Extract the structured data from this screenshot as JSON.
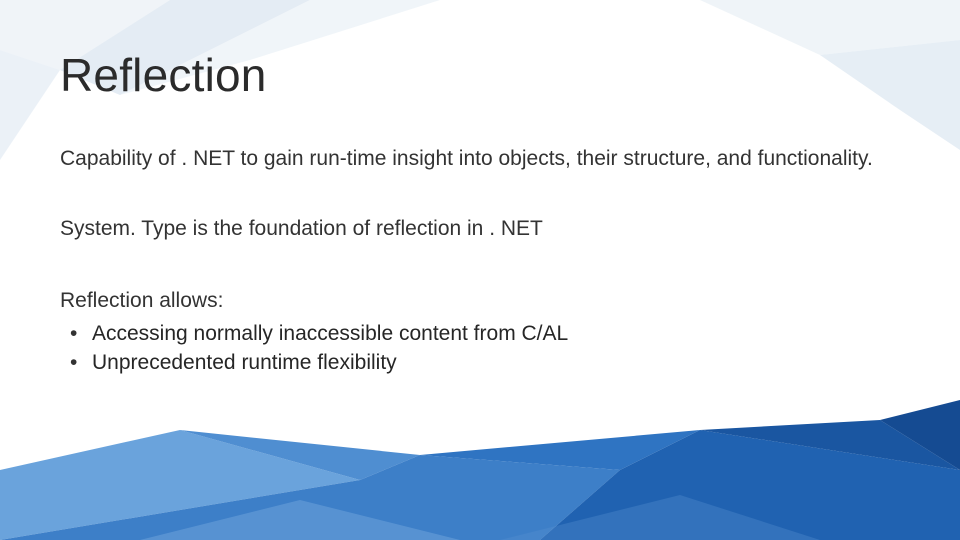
{
  "slide": {
    "title": "Reflection",
    "paragraph1": "Capability of . NET to gain run-time insight into objects, their structure, and functionality.",
    "paragraph2": "System. Type is the foundation of reflection in . NET",
    "allows_head": "Reflection allows:",
    "bullets": [
      "Accessing normally inaccessible content from C/AL",
      "Unprecedented runtime flexibility"
    ]
  }
}
